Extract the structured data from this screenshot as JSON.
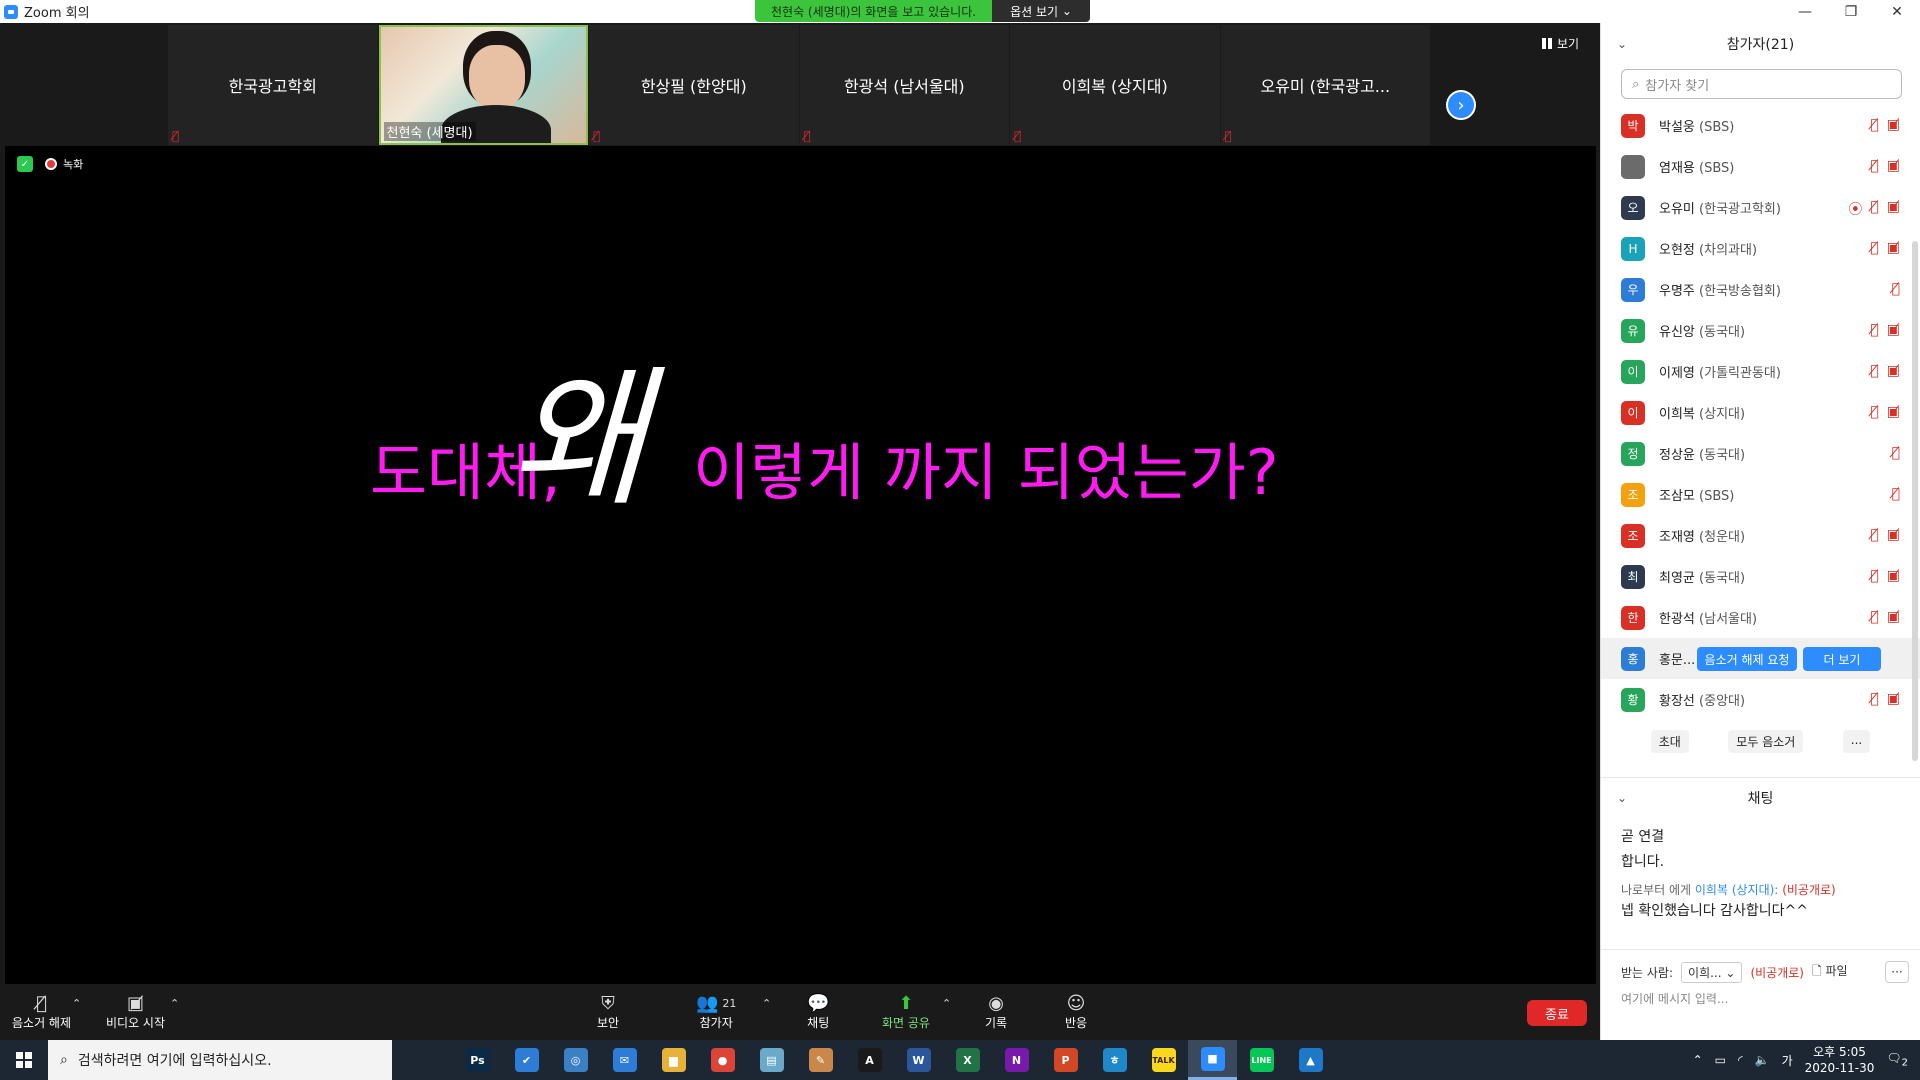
{
  "window": {
    "title": "Zoom 회의",
    "min_icon": "minimize-icon",
    "max_icon": "maximize-icon",
    "close_icon": "close-icon"
  },
  "share_banner": {
    "message": "천현숙 (세명대)의 화면을 보고 있습니다.",
    "options": "옵션 보기"
  },
  "thumbnails": [
    {
      "name": "한국광고학회"
    },
    {
      "name": "천현숙 (세명대)"
    },
    {
      "name": "한상필 (한양대)"
    },
    {
      "name": "한광석 (남서울대)"
    },
    {
      "name": "이희복 (상지대)"
    },
    {
      "name": "오유미 (한국광고..."
    }
  ],
  "view_button": "보기",
  "recording": {
    "label": "녹화"
  },
  "slide": {
    "part1": "도대체,",
    "emph": "왜",
    "part2": "이렇게 까지 되었는가?"
  },
  "toolbar": {
    "unmute": "음소거 해제",
    "start_video": "비디오 시작",
    "security": "보안",
    "participants": "참가자",
    "participants_count": "21",
    "chat": "채팅",
    "share_screen": "화면 공유",
    "record": "기록",
    "reactions": "반응",
    "end": "종료"
  },
  "participants_panel": {
    "title": "참가자(21)",
    "search_placeholder": "참가자 찾기",
    "items": [
      {
        "initial": "박",
        "name": "박설웅",
        "org": "(SBS)",
        "color": "#d93025"
      },
      {
        "initial": "",
        "name": "염재용",
        "org": "(SBS)",
        "color": "#6b6b6b"
      },
      {
        "initial": "오",
        "name": "오유미",
        "org": "(한국광고학회)",
        "color": "#2e3b4e"
      },
      {
        "initial": "H",
        "name": "오현정",
        "org": "(차의과대)",
        "color": "#1aa3b8"
      },
      {
        "initial": "우",
        "name": "우명주",
        "org": "(한국방송협회)",
        "color": "#2d7cd6"
      },
      {
        "initial": "유",
        "name": "유신앙",
        "org": "(동국대)",
        "color": "#27a55a"
      },
      {
        "initial": "이",
        "name": "이제영",
        "org": "(가톨릭관동대)",
        "color": "#27a55a"
      },
      {
        "initial": "이",
        "name": "이희복",
        "org": "(상지대)",
        "color": "#d93025"
      },
      {
        "initial": "정",
        "name": "정상윤",
        "org": "(동국대)",
        "color": "#27a55a"
      },
      {
        "initial": "조",
        "name": "조삼모",
        "org": "(SBS)",
        "color": "#f2a20f"
      },
      {
        "initial": "조",
        "name": "조재영",
        "org": "(청운대)",
        "color": "#d93025"
      },
      {
        "initial": "최",
        "name": "최영균",
        "org": "(동국대)",
        "color": "#2e3b4e"
      },
      {
        "initial": "한",
        "name": "한광석",
        "org": "(남서울대)",
        "color": "#d93025"
      },
      {
        "initial": "홍",
        "name": "홍문...",
        "org": "",
        "color": "#2d7cd6"
      },
      {
        "initial": "황",
        "name": "황장선",
        "org": "(중앙대)",
        "color": "#27a55a"
      }
    ],
    "unmute_request": "음소거 해제 요청",
    "more": "더 보기",
    "invite": "초대",
    "mute_all": "모두 음소거",
    "ellipsis": "..."
  },
  "chat_panel": {
    "title": "채팅",
    "lines": [
      "곧 연결",
      "합니다."
    ],
    "meta_from": "나로부터 에게",
    "meta_to": "이희복 (상지대):",
    "meta_priv": "(비공개로)",
    "message": "넵 확인했습니다 감사합니다^^",
    "recipient_label": "받는 사람:",
    "recipient": "이희...",
    "recipient_priv": "(비공개로)",
    "file": "파일",
    "input_placeholder": "여기에 메시지 입력..."
  },
  "taskbar": {
    "search_placeholder": "검색하려면 여기에 입력하십시오.",
    "apps": [
      {
        "icon": "task-view-icon",
        "label": "",
        "color": "#1c2733"
      },
      {
        "icon": "photoshop-icon",
        "label": "Ps",
        "color": "#0b2a45"
      },
      {
        "icon": "todo-icon",
        "label": "✔",
        "color": "#2d7cd6"
      },
      {
        "icon": "app-globe-icon",
        "label": "◎",
        "color": "#3b7fc4"
      },
      {
        "icon": "mail-icon",
        "label": "✉",
        "color": "#2d7cd6"
      },
      {
        "icon": "explorer-icon",
        "label": "▆",
        "color": "#e8b23a"
      },
      {
        "icon": "chrome-icon",
        "label": "●",
        "color": "#db4437"
      },
      {
        "icon": "notes-icon",
        "label": "▤",
        "color": "#6aa9c9"
      },
      {
        "icon": "paint-icon",
        "label": "✎",
        "color": "#c9884a"
      },
      {
        "icon": "acrobat-icon",
        "label": "A",
        "color": "#1a1a1a"
      },
      {
        "icon": "word-icon",
        "label": "W",
        "color": "#2b579a"
      },
      {
        "icon": "excel-icon",
        "label": "X",
        "color": "#217346"
      },
      {
        "icon": "onenote-icon",
        "label": "N",
        "color": "#7719aa"
      },
      {
        "icon": "powerpoint-icon",
        "label": "P",
        "color": "#d24726"
      },
      {
        "icon": "hwp-icon",
        "label": "ㅎ",
        "color": "#1e88c8"
      },
      {
        "icon": "kakaotalk-icon",
        "label": "TALK",
        "color": "#f9d71c"
      },
      {
        "icon": "zoom-icon",
        "label": "■",
        "color": "#2d8cff"
      },
      {
        "icon": "line-icon",
        "label": "LINE",
        "color": "#06c755"
      },
      {
        "icon": "photos-icon",
        "label": "▲",
        "color": "#1e78c8"
      }
    ],
    "ime": "가",
    "time_ampm": "오후 5:05",
    "date": "2020-11-30",
    "notif_count": "2"
  }
}
